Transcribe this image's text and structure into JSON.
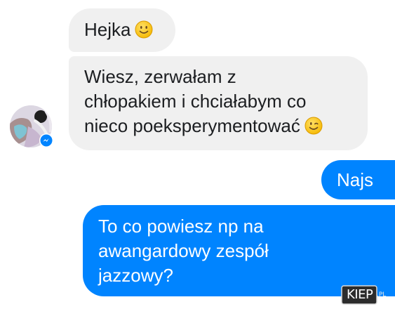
{
  "conversation": {
    "messages": [
      {
        "sender": "contact",
        "text": "Hejka",
        "emoji": "smiling-face-icon"
      },
      {
        "sender": "contact",
        "text": "Wiesz, zerwałam z\nchłopakiem i chciałabym co\nnieco poeksperymentować",
        "emoji": "winking-face-icon"
      },
      {
        "sender": "me",
        "text": "Najs"
      },
      {
        "sender": "me",
        "text": "To co powiesz np na\nawangardowy zespół\njazzowy?"
      }
    ]
  },
  "contact": {
    "avatar_icon": "contact-avatar",
    "badge_icon": "messenger-badge-icon"
  },
  "watermark": {
    "text": "KIEP",
    "suffix": ".PL"
  },
  "colors": {
    "incoming_bubble": "#f0f0f0",
    "outgoing_bubble": "#0084ff",
    "messenger_blue": "#0084ff",
    "emoji_yellow": "#fcc21b"
  }
}
